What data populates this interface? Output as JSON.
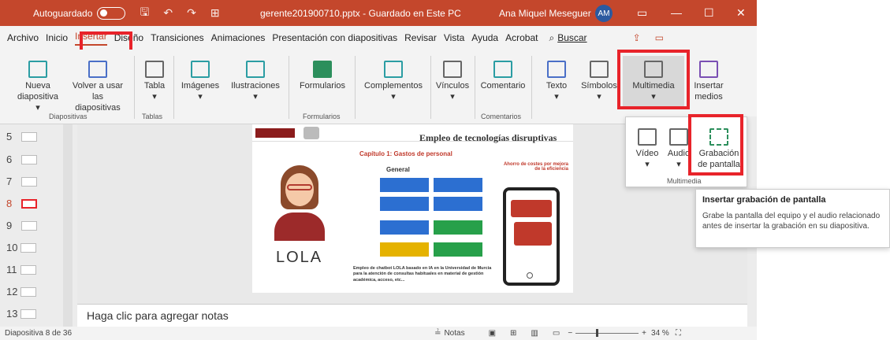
{
  "titlebar": {
    "autosave_label": "Autoguardado",
    "filename": "gerente201900710.pptx - Guardado en Este PC",
    "user": "Ana Miquel Meseguer",
    "avatar": "AM"
  },
  "menu": {
    "tabs": [
      "Archivo",
      "Inicio",
      "Insertar",
      "Diseño",
      "Transiciones",
      "Animaciones",
      "Presentación con diapositivas",
      "Revisar",
      "Vista",
      "Ayuda",
      "Acrobat"
    ],
    "search": "Buscar"
  },
  "ribbon": {
    "new_slide": [
      "Nueva",
      "diapositiva ▾"
    ],
    "reuse": [
      "Volver a usar",
      "las diapositivas"
    ],
    "table": "Tabla",
    "images": "Imágenes",
    "illustrations": "Ilustraciones",
    "forms": "Formularios",
    "addins": "Complementos",
    "links": "Vínculos",
    "comment": "Comentario",
    "text": "Texto",
    "symbols": "Símbolos",
    "multimedia": "Multimedia",
    "insert_media": [
      "Insertar",
      "medios"
    ],
    "groups": {
      "slides": "Diapositivas",
      "tables": "Tablas",
      "forms": "Formularios",
      "comments": "Comentarios"
    }
  },
  "thumbnails": [
    "5",
    "6",
    "7",
    "8",
    "9",
    "10",
    "11",
    "12",
    "13"
  ],
  "slide": {
    "title": "Empleo de tecnologías disruptivas",
    "chapter": "Capítulo 1: Gastos de personal",
    "general": "General",
    "savings": [
      "Ahorro de costes por mejora",
      "de la eficiencia"
    ],
    "lola": "LOLA",
    "body": "Empleo de chatbot LOLA basado en IA en la Universidad de Murcia para la atención de consultas habituales en material de gestión académica, acceso, etc..."
  },
  "multimedia_dropdown": {
    "video": "Vídeo",
    "audio": "Audio",
    "screen_recording": [
      "Grabación",
      "de pantalla"
    ],
    "group_label": "Multimedia"
  },
  "tooltip": {
    "title": "Insertar grabación de pantalla",
    "body": "Grabe la pantalla del equipo y el audio relacionado antes de insertar la grabación en su diapositiva."
  },
  "notes_placeholder": "Haga clic para agregar notas",
  "status": {
    "slide_info": "Diapositiva 8 de 36",
    "notes": "Notas",
    "zoom": "34 %"
  }
}
